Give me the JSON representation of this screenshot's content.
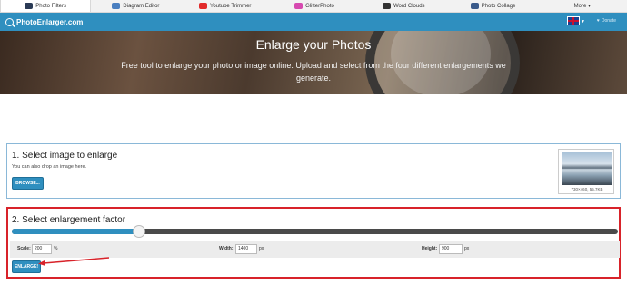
{
  "tabs": [
    {
      "label": "Photo Filters",
      "icon": "globe-icon",
      "color": "#2a3a55"
    },
    {
      "label": "Diagram Editor",
      "icon": "diagram-icon",
      "color": "#4a7fc0"
    },
    {
      "label": "Youtube Trimmer",
      "icon": "youtube-icon",
      "color": "#e22b2b"
    },
    {
      "label": "GlitterPhoto",
      "icon": "glitter-icon",
      "color": "#d64ab0"
    },
    {
      "label": "Word Clouds",
      "icon": "cloud-icon",
      "color": "#333333"
    },
    {
      "label": "Photo Collage",
      "icon": "collage-icon",
      "color": "#3a5a8a"
    },
    {
      "label": "More ▾",
      "icon": "",
      "color": ""
    }
  ],
  "header": {
    "logo": "PhotoEnlarger.com",
    "donate": "Donate"
  },
  "hero": {
    "title": "Enlarge your Photos",
    "subtitle": "Free tool to enlarge your photo or image online. Upload and select from the four different enlargements we generate."
  },
  "step1": {
    "title": "1. Select image to enlarge",
    "subtitle": "You can also drop an image here.",
    "browse": "BROWSE...",
    "thumb_caption": "730×460, 55.7KB"
  },
  "step2": {
    "title": "2. Select enlargement factor",
    "slider_fraction": 0.21,
    "scale": {
      "label": "Scale",
      "value": "200",
      "unit": "%"
    },
    "width": {
      "label": "Width",
      "value": "1400",
      "unit": "px"
    },
    "height": {
      "label": "Height",
      "value": "900",
      "unit": "px"
    },
    "enlarge": "ENLARGE!"
  },
  "colors": {
    "accent": "#2f8fbf",
    "highlight": "#d8232a"
  }
}
